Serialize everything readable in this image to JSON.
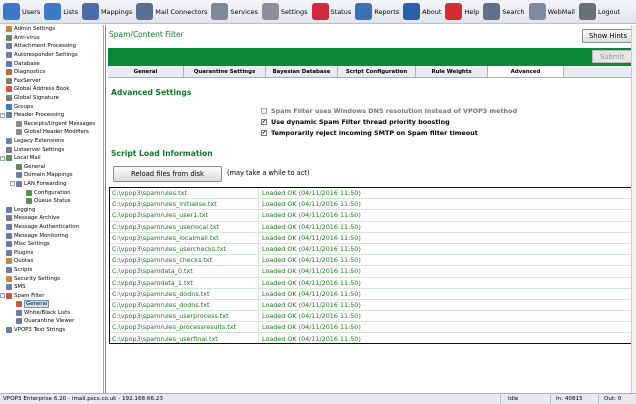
{
  "toolbar": [
    {
      "label": "Users",
      "icon": "users-icon",
      "color": "#3d79c9"
    },
    {
      "label": "Lists",
      "icon": "lists-icon",
      "color": "#3d79c9"
    },
    {
      "label": "Mappings",
      "icon": "mappings-icon",
      "color": "#4e6aa8"
    },
    {
      "label": "Mail Connectors",
      "icon": "mail-connectors-icon",
      "color": "#5a6f93"
    },
    {
      "label": "Services",
      "icon": "services-icon",
      "color": "#7f8896"
    },
    {
      "label": "Settings",
      "icon": "settings-icon",
      "color": "#8a8f98"
    },
    {
      "label": "Status",
      "icon": "status-heart-icon",
      "color": "#d3283a"
    },
    {
      "label": "Reports",
      "icon": "reports-icon",
      "color": "#3c70b8"
    },
    {
      "label": "About",
      "icon": "about-icon",
      "color": "#2a5fab"
    },
    {
      "label": "Help",
      "icon": "help-icon",
      "color": "#d22f2f"
    },
    {
      "label": "Search",
      "icon": "search-icon",
      "color": "#617086"
    },
    {
      "label": "WebMail",
      "icon": "webmail-icon",
      "color": "#7d8aa0"
    },
    {
      "label": "Logout",
      "icon": "logout-icon",
      "color": "#6b6f78"
    }
  ],
  "tree": [
    {
      "label": "Admin Settings",
      "level": 0,
      "toggle": "",
      "color": "#c5883e"
    },
    {
      "label": "Anti-virus",
      "level": 0,
      "toggle": "",
      "color": "#5f8f5f"
    },
    {
      "label": "Attachment Processing",
      "level": 0,
      "toggle": "",
      "color": "#6c7ca3"
    },
    {
      "label": "Autoresponder Settings",
      "level": 0,
      "toggle": "",
      "color": "#6c7ca3"
    },
    {
      "label": "Database",
      "level": 0,
      "toggle": "",
      "color": "#4f7fb9"
    },
    {
      "label": "Diagnostics",
      "level": 0,
      "toggle": "",
      "color": "#b46a3f"
    },
    {
      "label": "FaxServer",
      "level": 0,
      "toggle": "",
      "color": "#7c7c7c"
    },
    {
      "label": "Global Address Book",
      "level": 0,
      "toggle": "",
      "color": "#c9583f"
    },
    {
      "label": "Global Signature",
      "level": 0,
      "toggle": "",
      "color": "#7c7c7c"
    },
    {
      "label": "Groups",
      "level": 0,
      "toggle": "",
      "color": "#3d79c9"
    },
    {
      "label": "Header Processing",
      "level": 0,
      "toggle": "-",
      "color": "#6c7ca3"
    },
    {
      "label": "Receipts/Urgent Messages",
      "level": 1,
      "toggle": "",
      "color": "#8c8c8c"
    },
    {
      "label": "Global Header Modifiers",
      "level": 1,
      "toggle": "",
      "color": "#8c8c8c"
    },
    {
      "label": "Legacy Extensions",
      "level": 0,
      "toggle": "",
      "color": "#6c7ca3"
    },
    {
      "label": "Listserver Settings",
      "level": 0,
      "toggle": "",
      "color": "#6c7ca3"
    },
    {
      "label": "Local Mail",
      "level": 0,
      "toggle": "-",
      "color": "#5a8f5a"
    },
    {
      "label": "General",
      "level": 1,
      "toggle": "",
      "color": "#5a8f5a"
    },
    {
      "label": "Domain Mappings",
      "level": 1,
      "toggle": "",
      "color": "#6c7ca3"
    },
    {
      "label": "LAN Forwarding",
      "level": 1,
      "toggle": "-",
      "color": "#6c7ca3"
    },
    {
      "label": "Configuration",
      "level": 2,
      "toggle": "",
      "color": "#5a8f5a"
    },
    {
      "label": "Queue Status",
      "level": 2,
      "toggle": "",
      "color": "#5a8f5a"
    },
    {
      "label": "Logging",
      "level": 0,
      "toggle": "",
      "color": "#6c7ca3"
    },
    {
      "label": "Message Archive",
      "level": 0,
      "toggle": "",
      "color": "#6c7ca3"
    },
    {
      "label": "Message Authentication",
      "level": 0,
      "toggle": "",
      "color": "#6c7ca3"
    },
    {
      "label": "Message Monitoring",
      "level": 0,
      "toggle": "",
      "color": "#6c7ca3"
    },
    {
      "label": "Misc Settings",
      "level": 0,
      "toggle": "",
      "color": "#6c7ca3"
    },
    {
      "label": "Plugins",
      "level": 0,
      "toggle": "",
      "color": "#6c7ca3"
    },
    {
      "label": "Quotas",
      "level": 0,
      "toggle": "",
      "color": "#c5883e"
    },
    {
      "label": "Scripts",
      "level": 0,
      "toggle": "",
      "color": "#6c7ca3"
    },
    {
      "label": "Security Settings",
      "level": 0,
      "toggle": "",
      "color": "#c5883e"
    },
    {
      "label": "SMS",
      "level": 0,
      "toggle": "",
      "color": "#6c7ca3"
    },
    {
      "label": "Spam Filter",
      "level": 0,
      "toggle": "-",
      "color": "#c9583f"
    },
    {
      "label": "General",
      "level": 1,
      "toggle": "",
      "color": "#c9583f",
      "selected": true
    },
    {
      "label": "White/Black Lists",
      "level": 1,
      "toggle": "",
      "color": "#6c7ca3"
    },
    {
      "label": "Quarantine Viewer",
      "level": 1,
      "toggle": "",
      "color": "#6c7ca3"
    },
    {
      "label": "VPOP3 Text Strings",
      "level": 0,
      "toggle": "",
      "color": "#6c7ca3"
    }
  ],
  "main": {
    "title": "Spam/Content Filter",
    "show_hints": "Show Hints",
    "submit": "Submit",
    "tabs": [
      {
        "label": "General",
        "active": false
      },
      {
        "label": "Quarantine Settings",
        "active": false
      },
      {
        "label": "Bayesian Database",
        "active": false
      },
      {
        "label": "Script Configuration",
        "active": false
      },
      {
        "label": "Rule Weights",
        "active": false
      },
      {
        "label": "Advanced",
        "active": true
      }
    ],
    "advanced_title": "Advanced Settings",
    "options": [
      {
        "label": "Spam Filter uses Windows DNS resolution instead of VPOP3 method",
        "checked": false,
        "enabled": false
      },
      {
        "label": "Use dynamic Spam Filter thread priority boosting",
        "checked": true,
        "enabled": true
      },
      {
        "label": "Temporarily reject incoming SMTP on Spam filter timeout",
        "checked": true,
        "enabled": true
      }
    ],
    "script_title": "Script Load Information",
    "reload_button": "Reload files from disk",
    "reload_note": "(may take a while to act)",
    "scripts": [
      {
        "file": "C:\\vpop3\\spamrules.txt",
        "status": "Loaded OK (04/11/2016 11:50)"
      },
      {
        "file": "C:\\vpop3\\spamrules_initialise.txt",
        "status": "Loaded OK (04/11/2016 11:50)"
      },
      {
        "file": "C:\\vpop3\\spamrules_user1.txt",
        "status": "Loaded OK (04/11/2016 11:50)"
      },
      {
        "file": "C:\\vpop3\\spamrules_userlocal.txt",
        "status": "Loaded OK (04/11/2016 11:50)"
      },
      {
        "file": "C:\\vpop3\\spamrules_localmail.txt",
        "status": "Loaded OK (04/11/2016 11:50)"
      },
      {
        "file": "C:\\vpop3\\spamrules_userchecks.txt",
        "status": "Loaded OK (04/11/2016 11:50)"
      },
      {
        "file": "C:\\vpop3\\spamrules_checks.txt",
        "status": "Loaded OK (04/11/2016 11:50)"
      },
      {
        "file": "C:\\vpop3\\spamdata_0.txt",
        "status": "Loaded OK (04/11/2016 11:50)"
      },
      {
        "file": "C:\\vpop3\\spamdata_1.txt",
        "status": "Loaded OK (04/11/2016 11:50)"
      },
      {
        "file": "C:\\vpop3\\spamrules_dodns.txt",
        "status": "Loaded OK (04/11/2016 11:50)"
      },
      {
        "file": "C:\\vpop3\\spamrules_dodns.txt",
        "status": "Loaded OK (04/11/2016 11:50)"
      },
      {
        "file": "C:\\vpop3\\spamrules_userprocess.txt",
        "status": "Loaded OK (04/11/2016 11:50)"
      },
      {
        "file": "C:\\vpop3\\spamrules_processresults.txt",
        "status": "Loaded OK (04/11/2016 11:50)"
      },
      {
        "file": "C:\\vpop3\\spamrules_userfinal.txt",
        "status": "Loaded OK (04/11/2016 11:50)"
      }
    ]
  },
  "status_bar": {
    "product": "VPOP3 Enterprise 6.20 - imail.pscs.co.uk - 192.168.66.23",
    "state": "Idle",
    "in": "In: 40815",
    "out": "Out: 0"
  },
  "colors": {
    "accent": "#0a8a35",
    "heading": "#0f7a2a",
    "script_text": "#1e7a1e"
  }
}
